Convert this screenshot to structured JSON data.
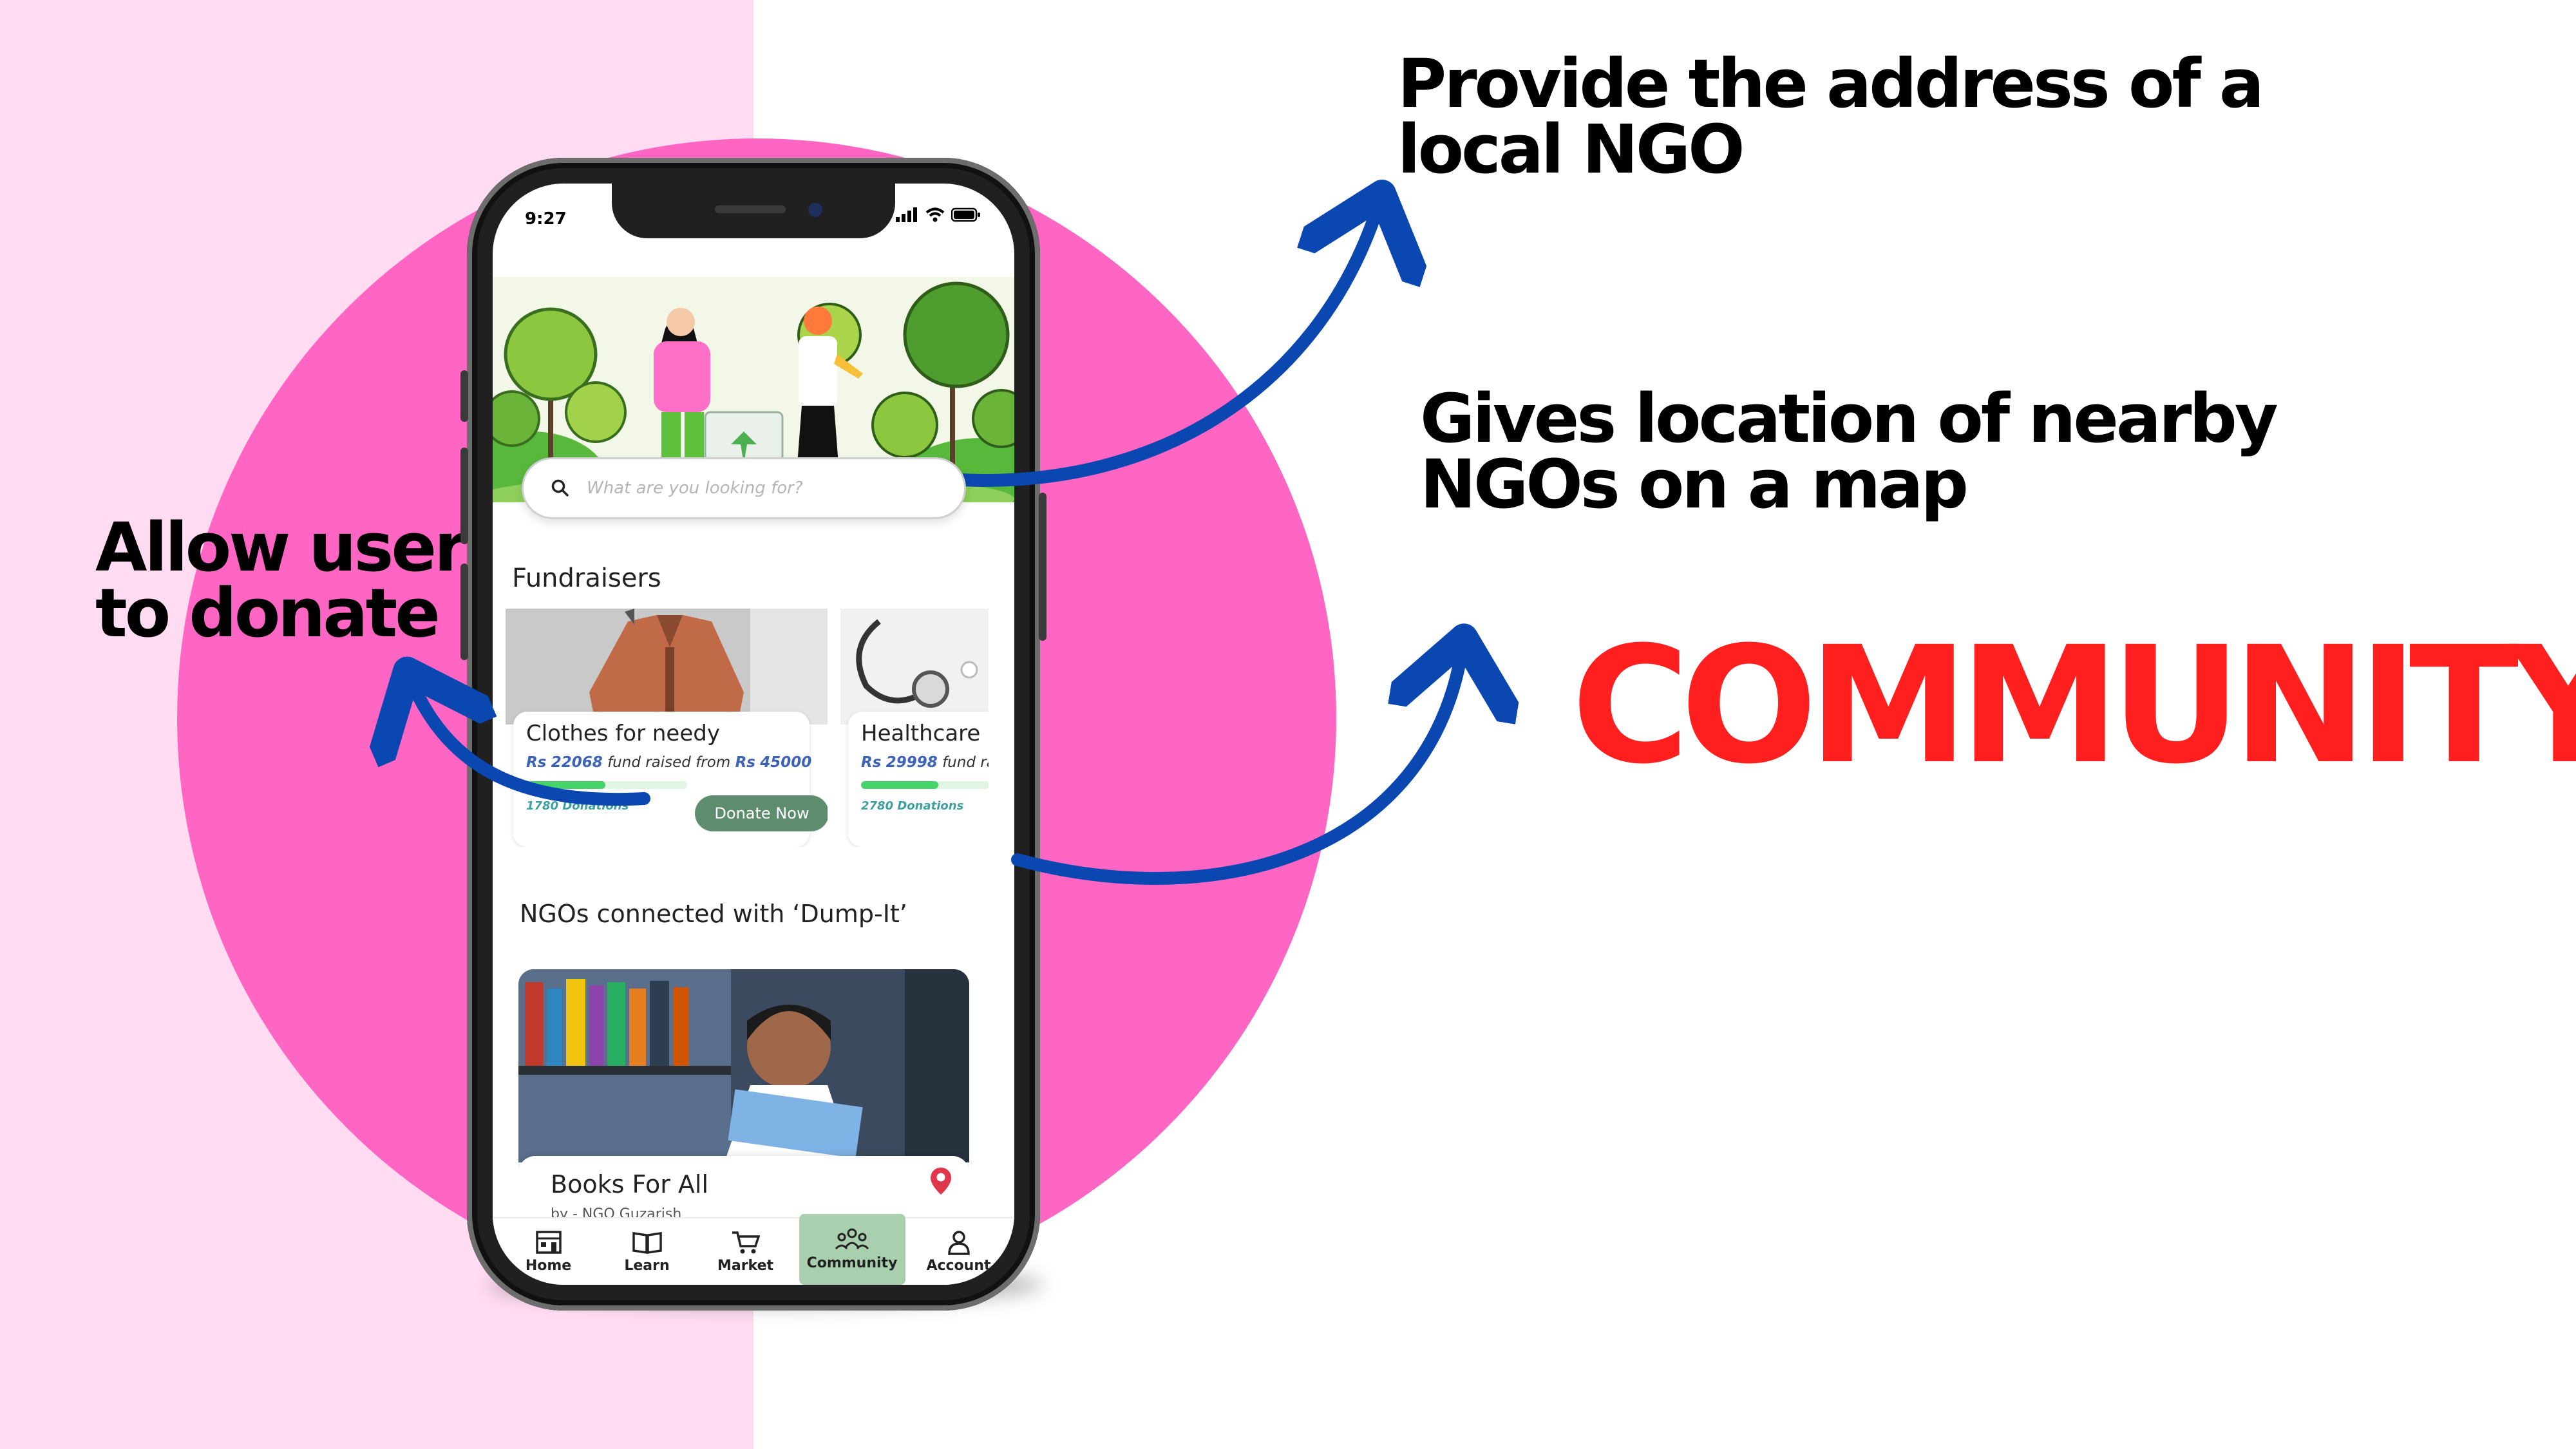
{
  "slide": {
    "section_title": "COMMUNITY",
    "callouts": {
      "address": "Provide the address of a local NGO",
      "map": "Gives location of nearby NGOs on a map",
      "donate": "Allow users to donate"
    },
    "colors": {
      "accent_pink": "#ff66c4",
      "left_band": "#ffdcf2",
      "title_red": "#ff1f1f",
      "arrow_blue": "#0a47b0"
    }
  },
  "phone": {
    "status_time": "9:27",
    "search": {
      "placeholder": "What are you looking for?"
    },
    "fundraisers": {
      "heading": "Fundraisers",
      "cards": [
        {
          "title": "Clothes for needy",
          "currency": "Rs",
          "raised": "22068",
          "raised_text": "fund raised from",
          "goal": "45000",
          "progress": 0.49,
          "donations": "1780 Donations",
          "button": "Donate Now"
        },
        {
          "title": "Healthcare",
          "currency": "Rs",
          "raised": "29998",
          "raised_text": "fund ra",
          "donations": "2780 Donations",
          "progress": 0.6
        }
      ]
    },
    "ngos": {
      "heading": "NGOs connected with ‘Dump-It’",
      "card": {
        "title": "Books For All",
        "subtitle": "by - NGO Guzarish"
      }
    },
    "tabs": [
      {
        "label": "Home",
        "icon": "home-icon"
      },
      {
        "label": "Learn",
        "icon": "book-icon"
      },
      {
        "label": "Market",
        "icon": "cart-icon"
      },
      {
        "label": "Community",
        "icon": "community-icon",
        "active": true
      },
      {
        "label": "Account",
        "icon": "account-icon"
      }
    ]
  }
}
